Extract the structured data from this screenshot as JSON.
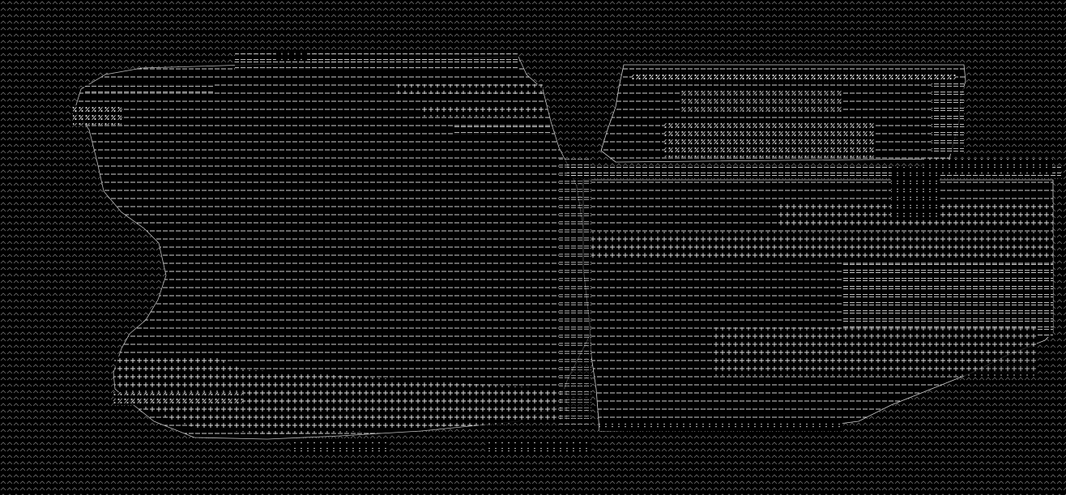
{
  "image": {
    "kind": "ascii-art",
    "background_color": "#000000",
    "glyph_color": "#e6e6e6",
    "dim_glyph_color": "#8a8a8a",
    "glyphs": {
      "background_fill": "^",
      "light": "-",
      "medium": "=",
      "dense": "+",
      "heavy": "*",
      "accent": "%",
      "dot": ":"
    }
  }
}
